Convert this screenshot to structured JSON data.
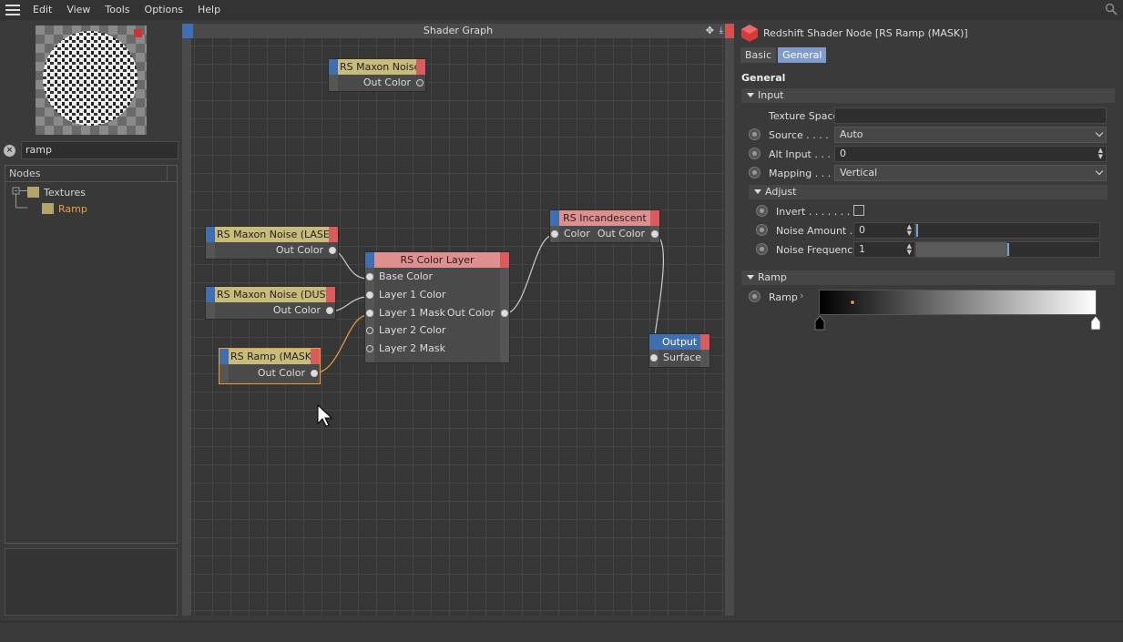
{
  "menu": {
    "items": [
      "Edit",
      "View",
      "Tools",
      "Options",
      "Help"
    ]
  },
  "left": {
    "search_value": "ramp",
    "nodes_header": "Nodes",
    "tree": [
      {
        "label": "Textures",
        "level": 0,
        "highlight": false
      },
      {
        "label": "Ramp",
        "level": 1,
        "highlight": true
      }
    ]
  },
  "graph": {
    "title": "Shader Graph",
    "nodes": {
      "maxon_noise": {
        "title": "RS Maxon Noise",
        "out": "Out Color"
      },
      "maxon_laser": {
        "title": "RS Maxon Noise (LASER)",
        "out": "Out Color"
      },
      "maxon_dust": {
        "title": "RS Maxon Noise (DUST)",
        "out": "Out Color"
      },
      "ramp_mask": {
        "title": "RS Ramp (MASK)",
        "out": "Out Color"
      },
      "color_layer": {
        "title": "RS Color Layer",
        "inputs": [
          "Base Color",
          "Layer 1 Color",
          "Layer 1 Mask",
          "Layer 2 Color",
          "Layer 2 Mask"
        ],
        "out": "Out Color"
      },
      "incandescent": {
        "title": "RS Incandescent",
        "in": "Color",
        "out": "Out Color"
      },
      "output": {
        "title": "Output",
        "in": "Surface"
      }
    }
  },
  "inspector": {
    "title": "Redshift Shader Node [RS Ramp (MASK)]",
    "tabs": [
      "Basic",
      "General"
    ],
    "active_tab": "General",
    "section": "General",
    "input_group": "Input",
    "texture_space_label": "Texture Space",
    "source_label": "Source . . . .",
    "source_value": "Auto",
    "alt_input_label": "Alt Input . . .",
    "alt_input_value": "0",
    "mapping_label": "Mapping . . .",
    "mapping_value": "Vertical",
    "adjust_group": "Adjust",
    "invert_label": "Invert . . . . . . .",
    "noise_amount_label": "Noise Amount .",
    "noise_amount_value": "0",
    "noise_frequency_label": "Noise Frequency",
    "noise_frequency_value": "1",
    "ramp_group": "Ramp",
    "ramp_label": "Ramp"
  },
  "colors": {
    "accent": "#7f9ccb",
    "node_red": "#d95b5b",
    "node_blue": "#3f6fb0",
    "selected": "#f0a030"
  }
}
